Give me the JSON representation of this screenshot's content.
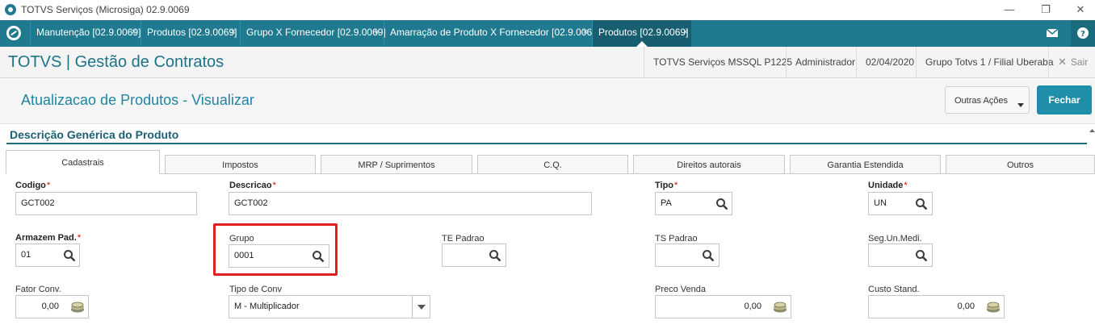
{
  "window": {
    "title": "TOTVS Serviços (Microsiga) 02.9.0069",
    "controls": [
      "—",
      "❐",
      "✕"
    ]
  },
  "tabs": [
    {
      "label": "Manutenção [02.9.0069]",
      "close": "×"
    },
    {
      "label": "Produtos [02.9.0069]",
      "close": "×"
    },
    {
      "label": "Grupo X Fornecedor [02.9.0069]",
      "close": "×"
    },
    {
      "label": "Amarração de Produto X Fornecedor [02.9.0069]",
      "close": "×"
    },
    {
      "label": "Produtos [02.9.0069]",
      "close": "×",
      "active": true
    }
  ],
  "header": {
    "app_title": "TOTVS | Gestão de Contratos",
    "server": "TOTVS Serviços MSSQL P1225",
    "user": "Administrador",
    "date": "02/04/2020",
    "branch": "Grupo Totvs 1 / Filial Uberaba",
    "exit_label": "Sair"
  },
  "page": {
    "title": "Atualizacao de Produtos - Visualizar",
    "other_actions_label": "Outras Ações",
    "close_label": "Fechar"
  },
  "section": {
    "title": "Descrição Genérica do Produto"
  },
  "form_tabs": [
    "Cadastrais",
    "Impostos",
    "MRP / Suprimentos",
    "C.Q.",
    "Direitos autorais",
    "Garantia Estendida",
    "Outros"
  ],
  "fields": {
    "codigo": {
      "label": "Codigo",
      "value": "GCT002"
    },
    "descricao": {
      "label": "Descricao",
      "value": "GCT002"
    },
    "tipo": {
      "label": "Tipo",
      "value": "PA"
    },
    "unidade": {
      "label": "Unidade",
      "value": "UN"
    },
    "armazem": {
      "label": "Armazem Pad.",
      "value": "01"
    },
    "grupo": {
      "label": "Grupo",
      "value": "0001"
    },
    "te_padrao": {
      "label": "TE Padrao",
      "value": ""
    },
    "ts_padrao": {
      "label": "TS Padrao",
      "value": ""
    },
    "seg_un": {
      "label": "Seg.Un.Medi.",
      "value": ""
    },
    "fator_conv": {
      "label": "Fator Conv.",
      "value": "0,00"
    },
    "tipo_conv": {
      "label": "Tipo de Conv",
      "value": "M - Multiplicador"
    },
    "preco_venda": {
      "label": "Preco Venda",
      "value": "0,00"
    },
    "custo_stand": {
      "label": "Custo Stand.",
      "value": "0,00"
    }
  },
  "required_marker": "*",
  "colors": {
    "accent": "#1f7a8f",
    "primary_button": "#1e8ea9",
    "required": "#d20000",
    "highlight": "#e02020"
  }
}
